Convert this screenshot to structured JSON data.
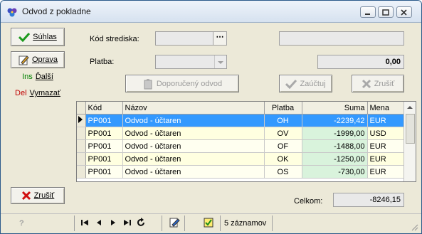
{
  "window": {
    "title": "Odvod z pokladne"
  },
  "left_panel": {
    "suhlas_label": "Súhlas",
    "oprava_label": "Oprava",
    "dalsi_prefix": "Ins",
    "dalsi_label": "Ďalší",
    "vymazat_prefix": "Del",
    "vymazat_label": "Vymazať",
    "zrusit_label": "Zrušiť"
  },
  "form": {
    "kod_strediska_label": "Kód strediska:",
    "kod_strediska_value": "",
    "stredisko_name_value": "",
    "platba_label": "Platba:",
    "platba_value": "",
    "amount_value": "0,00",
    "doporuceny_label": "Doporučený odvod",
    "zauctuj_label": "Zaúčtuj",
    "zrusit_label": "Zrušiť"
  },
  "grid": {
    "columns": [
      "Kód",
      "Názov",
      "Platba",
      "Suma",
      "Mena"
    ],
    "rows": [
      {
        "kod": "PP001",
        "nazov": "Odvod - účtaren",
        "platba": "OH",
        "suma": "-2239,42",
        "mena": "EUR",
        "selected": true
      },
      {
        "kod": "PP001",
        "nazov": "Odvod - účtaren",
        "platba": "OV",
        "suma": "-1999,00",
        "mena": "USD",
        "selected": false
      },
      {
        "kod": "PP001",
        "nazov": "Odvod - účtaren",
        "platba": "OF",
        "suma": "-1488,00",
        "mena": "EUR",
        "selected": false
      },
      {
        "kod": "PP001",
        "nazov": "Odvod - účtaren",
        "platba": "OK",
        "suma": "-1250,00",
        "mena": "EUR",
        "selected": false
      },
      {
        "kod": "PP001",
        "nazov": "Odvod - účtaren",
        "platba": "OS",
        "suma": "-730,00",
        "mena": "EUR",
        "selected": false
      }
    ]
  },
  "total": {
    "label": "Celkom:",
    "value": "-8246,15"
  },
  "status": {
    "help_glyph": "?",
    "records": "5 záznamov"
  },
  "colors": {
    "selected_row": "#3399ff",
    "suma_cell": "#d9f3dc",
    "row_bg": "#ffffe0"
  }
}
